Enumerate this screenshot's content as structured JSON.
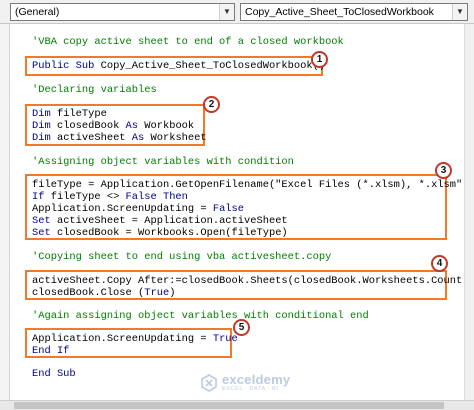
{
  "toolbar": {
    "object_combo": "(General)",
    "procedure_combo": "Copy_Active_Sheet_ToClosedWorkbook",
    "dropdown_glyph": "▼"
  },
  "code": {
    "line01": "'VBA copy active sheet to end of a closed workbook",
    "line02a": "Public Sub",
    "line02b": " Copy_Active_Sheet_ToClosedWorkbook()",
    "line03": "'Declaring variables",
    "line04a": "Dim",
    "line04b": " fileType",
    "line05a": "Dim",
    "line05b": " closedBook ",
    "line05c": "As",
    "line05d": " Workbook",
    "line06a": "Dim",
    "line06b": " activeSheet ",
    "line06c": "As",
    "line06d": " Worksheet",
    "line07": "'Assigning object variables with condition",
    "line08": "fileType = Application.GetOpenFilename(\"Excel Files (*.xlsm), *.xlsm\")",
    "line09a": "If",
    "line09b": " fileType <> ",
    "line09c": "False Then",
    "line10a": "Application.ScreenUpdating = ",
    "line10b": "False",
    "line11a": "Set",
    "line11b": " activeSheet = Application.activeSheet",
    "line12a": "Set",
    "line12b": " closedBook = Workbooks.Open(fileType)",
    "line13": "'Copying sheet to end using vba activesheet.copy",
    "line14": "activeSheet.Copy After:=closedBook.Sheets(closedBook.Worksheets.Count)",
    "line15a": "closedBook.Close (",
    "line15b": "True",
    "line15c": ")",
    "line16": "'Again assigning object variables with conditional end",
    "line17a": "Application.ScreenUpdating = ",
    "line17b": "True",
    "line18a": "End If",
    "line19a": "End Sub"
  },
  "badges": [
    "1",
    "2",
    "3",
    "4",
    "5"
  ],
  "watermark": {
    "name": "exceldemy",
    "tagline": "EXCEL · DATA · BI"
  },
  "colors": {
    "comment": "#008000",
    "keyword": "#00008b",
    "highlight_box": "#f07a2a",
    "badge_border": "#c0392b"
  }
}
